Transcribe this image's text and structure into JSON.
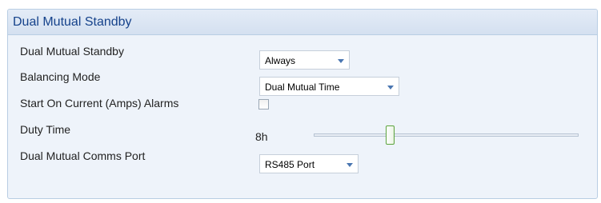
{
  "panel": {
    "title": "Dual Mutual Standby"
  },
  "rows": {
    "dual_mutual_standby": {
      "label": "Dual Mutual Standby",
      "value": "Always"
    },
    "balancing_mode": {
      "label": "Balancing Mode",
      "value": "Dual Mutual Time"
    },
    "start_on_current_alarms": {
      "label": "Start On Current (Amps) Alarms",
      "checked": false
    },
    "duty_time": {
      "label": "Duty Time",
      "value": "8h"
    },
    "comms_port": {
      "label": "Dual Mutual Comms Port",
      "value": "RS485 Port"
    }
  },
  "icons": {
    "dropdown": "chevron-down-icon"
  },
  "colors": {
    "header_text": "#15428b",
    "accent": "#4a76b1",
    "slider_thumb": "#5ba33c"
  }
}
